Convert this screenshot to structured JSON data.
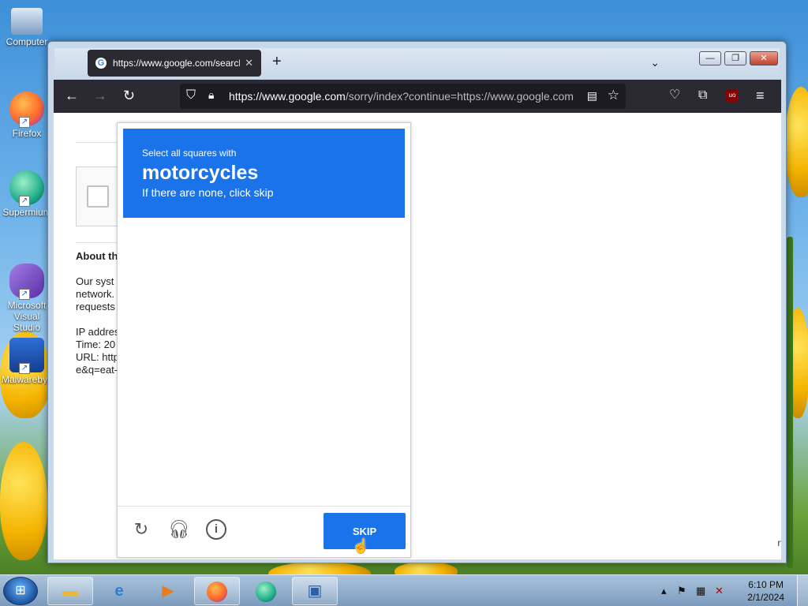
{
  "desktop": {
    "icons": [
      {
        "label": "Computer"
      },
      {
        "label": "Firefox"
      },
      {
        "label": "Supermium"
      },
      {
        "label": "Microsoft Visual Studio"
      },
      {
        "label": "Malwarebytes"
      }
    ]
  },
  "browser": {
    "tab_title": "https://www.google.com/search",
    "url_host": "https://www.google.com",
    "url_path": "/sorry/index?continue=https://www.google.com"
  },
  "page": {
    "about_title": "About th",
    "about_p1": "Our syst\nnetwork.\nrequests",
    "about_p2": "IP addres\nTime: 20\nURL: http\ne&q=eat-",
    "edge_text": "n"
  },
  "captcha": {
    "instruction": "Select all squares with",
    "target": "motorcycles",
    "subtext": "If there are none, click skip",
    "skip_label": "SKIP",
    "grid_rows": 4,
    "grid_cols": 4
  },
  "taskbar": {
    "time": "6:10 PM",
    "date": "2/1/2024"
  },
  "colors": {
    "captcha_blue": "#1a73e8",
    "browser_chrome": "#2b2a33"
  }
}
